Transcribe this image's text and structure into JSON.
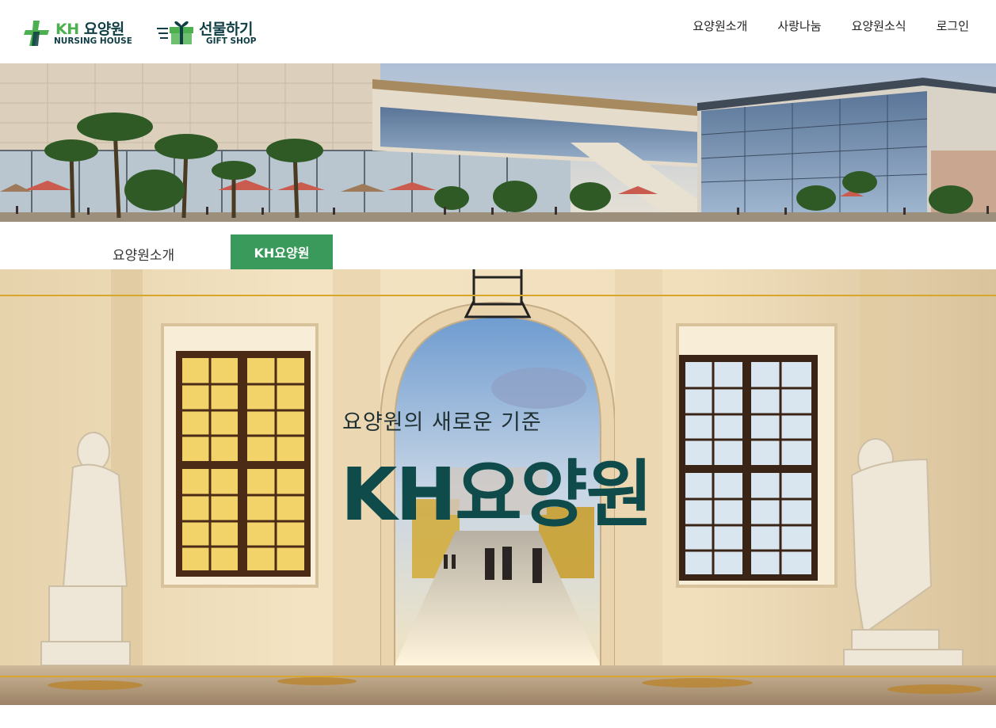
{
  "header": {
    "logo_kh": {
      "title_kh": "KH",
      "title_rest": " 요양원",
      "subtitle": "NURSING HOUSE"
    },
    "logo_gift": {
      "title": "선물하기",
      "subtitle": "GIFT SHOP"
    },
    "nav": [
      {
        "label": "요양원소개"
      },
      {
        "label": "사랑나눔"
      },
      {
        "label": "요양원소식"
      },
      {
        "label": "로그인"
      }
    ]
  },
  "tabs": {
    "section": "요양원소개",
    "active": "KH요양원"
  },
  "hero": {
    "subtitle": "요양원의 새로운 기준",
    "title": "KH요양원"
  },
  "colors": {
    "brand_dark": "#0f3f44",
    "brand_green": "#4caf50",
    "tab_active_bg": "#3a9a5c",
    "hero_title": "#0f4b4a"
  }
}
